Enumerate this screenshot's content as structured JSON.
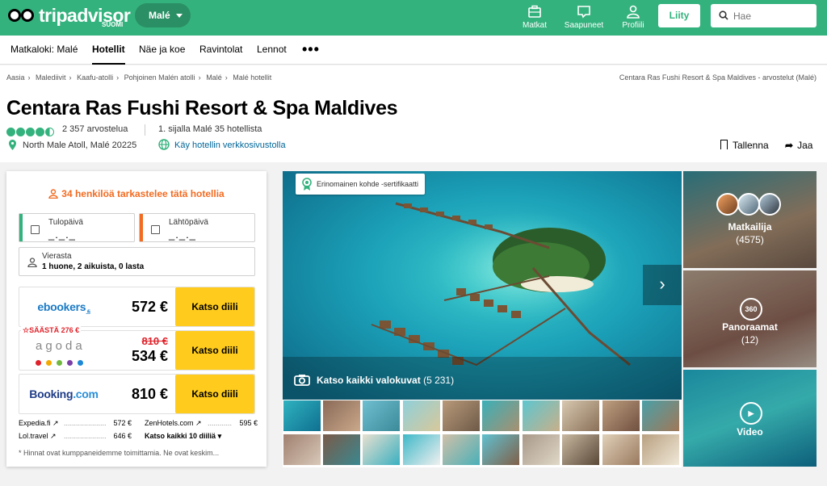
{
  "header": {
    "logo_text": "tripadvisor",
    "logo_sub": "SUOMI",
    "location_button": "Malé",
    "nav": [
      {
        "label": "Matkat",
        "icon": "briefcase-icon"
      },
      {
        "label": "Saapuneet",
        "icon": "chat-icon"
      },
      {
        "label": "Profiili",
        "icon": "person-icon"
      }
    ],
    "join_label": "Liity",
    "search_placeholder": "Hae"
  },
  "subnav": {
    "items": [
      "Matkaloki: Malé",
      "Hotellit",
      "Näe ja koe",
      "Ravintolat",
      "Lennot"
    ],
    "active": "Hotellit",
    "more": "•••"
  },
  "breadcrumbs": [
    "Aasia",
    "Malediivit",
    "Kaafu-atolli",
    "Pohjoinen Malén atolli",
    "Malé",
    "Malé hotellit"
  ],
  "breadcrumb_right": "Centara Ras Fushi Resort & Spa Maldives - arvostelut (Malé)",
  "hotel": {
    "name": "Centara Ras Fushi Resort & Spa Maldives",
    "rating": 4.5,
    "reviews": "2 357 arvostelua",
    "rank": "1. sijalla Malé 35 hotellista",
    "address": "North Male Atoll, Malé 20225",
    "website_link": "Käy hotellin verkkosivustolla",
    "save_label": "Tallenna",
    "share_label": "Jaa"
  },
  "booking": {
    "viewers": "34 henkilöä tarkastelee tätä hotellia",
    "checkin_label": "Tulopäivä",
    "checkin_value": "_._._",
    "checkout_label": "Lähtöpäivä",
    "checkout_value": "_._._",
    "guests_label": "Vierasta",
    "guests_value": "1 huone, 2 aikuista, 0 lasta",
    "deal_label": "Katso diili",
    "offers": [
      {
        "provider": "ebookers",
        "provider_suffix": ".fi",
        "price": "572 €"
      },
      {
        "provider": "agoda",
        "savings": "SÄÄSTÄ 276 €",
        "old_price": "810 €",
        "price": "534 €"
      },
      {
        "provider": "Booking",
        "provider_suffix": ".com",
        "price": "810 €"
      }
    ],
    "other_offers": [
      {
        "name": "Expedia.fi",
        "price": "572 €"
      },
      {
        "name": "ZenHotels.com",
        "price": "595 €"
      },
      {
        "name": "Lol.travel",
        "price": "646 €"
      }
    ],
    "see_all": "Katso kaikki 10 diiliä",
    "disclaimer": "* Hinnat ovat kumppaneidemme toimittamia. Ne ovat keskim..."
  },
  "gallery": {
    "certificate": "Erinomainen kohde -sertifikaatti",
    "see_photos": "Katso kaikki valokuvat",
    "photo_count": "(5 231)",
    "side": [
      {
        "label": "Matkailija",
        "count": "(4575)"
      },
      {
        "label": "Panoraamat",
        "count": "(12)",
        "badge": "360"
      },
      {
        "label": "Video"
      }
    ]
  },
  "colors": {
    "brand_green": "#34b27d",
    "deal_yellow": "#ffcc1d",
    "viewers_orange": "#f26b21",
    "sale_red": "#e0232b",
    "link_blue": "#006699"
  }
}
